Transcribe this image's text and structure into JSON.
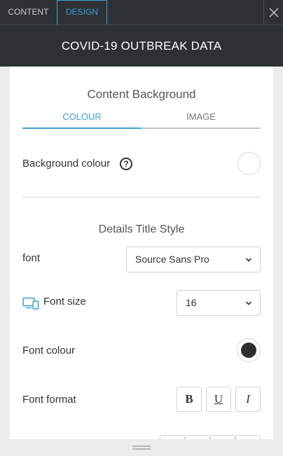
{
  "tabs": {
    "content": "CONTENT",
    "design": "DESIGN"
  },
  "header": {
    "title": "COVID-19 OUTBREAK DATA"
  },
  "content_background": {
    "title": "Content Background",
    "tab_colour": "COLOUR",
    "tab_image": "IMAGE",
    "background_colour_label": "Background colour",
    "help_symbol": "?",
    "background_colour_value": "#ffffff"
  },
  "details_title_style": {
    "title": "Details Title Style",
    "font_label": "font",
    "font_value": "Source Sans Pro",
    "font_size_label": "Font size",
    "font_size_value": "16",
    "font_colour_label": "Font colour",
    "font_colour_value": "#2f2f2f",
    "font_format_label": "Font format",
    "format_buttons": {
      "bold": "B",
      "underline": "U",
      "italic": "I"
    }
  },
  "colors": {
    "accent": "#3ea0d8",
    "dark_bar": "#2d3134"
  },
  "icons": [
    "close-icon",
    "help-icon",
    "chevron-down-icon",
    "devices-icon"
  ]
}
